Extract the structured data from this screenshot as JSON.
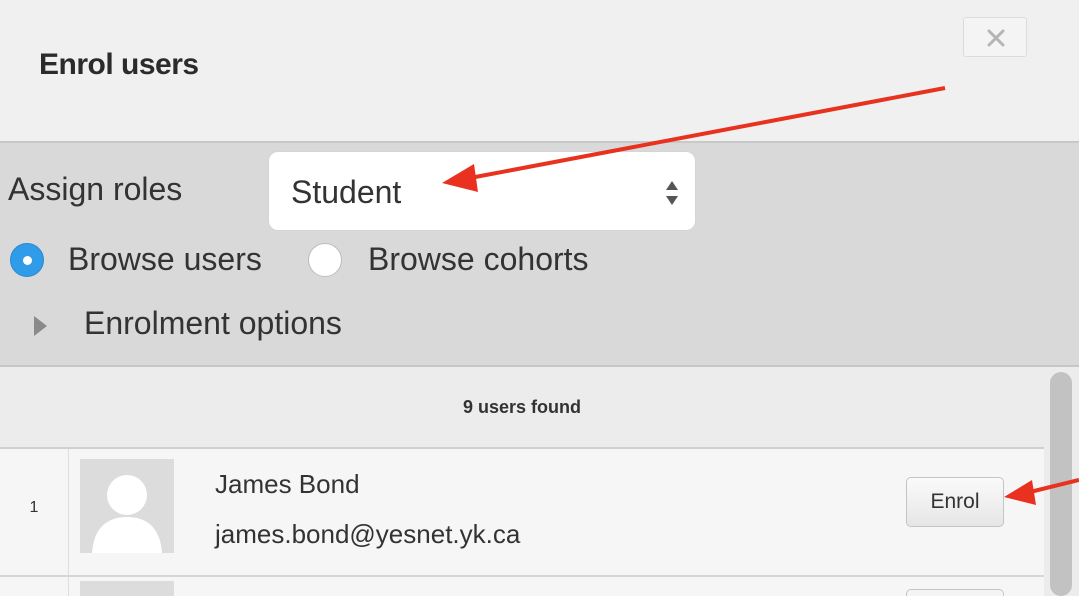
{
  "dialog": {
    "title": "Enrol users",
    "close_icon": "close-icon"
  },
  "controls": {
    "assign_roles_label": "Assign roles",
    "role_selected": "Student",
    "browse_users_label": "Browse users",
    "browse_cohorts_label": "Browse cohorts",
    "browse_users_selected": true,
    "enrolment_options_label": "Enrolment options"
  },
  "results": {
    "count_text": "9 users found",
    "users": [
      {
        "index": "1",
        "name": "James Bond",
        "email": "james.bond@yesnet.yk.ca",
        "action": "Enrol"
      }
    ]
  },
  "colors": {
    "annotation_arrow": "#e8321f",
    "radio_selected": "#2f9be9"
  }
}
